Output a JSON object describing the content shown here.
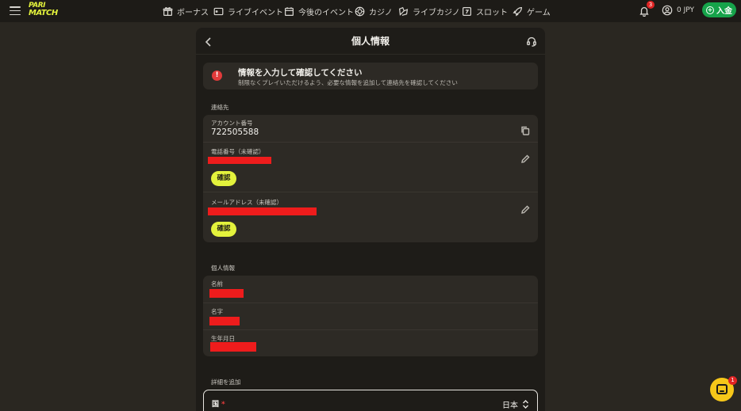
{
  "topbar": {
    "logo_line1": "PARI",
    "logo_line2": "MATCH",
    "nav": [
      {
        "label": "ボーナス",
        "icon": "gift-icon"
      },
      {
        "label": "ライブイベント",
        "icon": "live-tv-icon"
      },
      {
        "label": "今後のイベント",
        "icon": "calendar-icon"
      },
      {
        "label": "カジノ",
        "icon": "casino-chip-icon"
      },
      {
        "label": "ライブカジノ",
        "icon": "live-casino-icon"
      },
      {
        "label": "スロット",
        "icon": "slot-icon"
      },
      {
        "label": "ゲーム",
        "icon": "rocket-icon"
      }
    ],
    "notifications_count": "3",
    "balance": "0 JPY",
    "deposit_label": "入金"
  },
  "panel": {
    "title": "個人情報",
    "alert": {
      "title": "情報を入力して確認してください",
      "subtitle": "制限なくプレイいただけるよう、必要な情報を追加して連絡先を確認してください"
    },
    "contacts": {
      "section_label": "連絡先",
      "account_label": "アカウント番号",
      "account_value": "722505588",
      "phone_label": "電話番号（未確認）",
      "email_label": "メールアドレス（未確認）",
      "confirm_label": "確認"
    },
    "personal": {
      "section_label": "個人情報",
      "first_name_label": "名前",
      "last_name_label": "名字",
      "birthdate_label": "生年月日"
    },
    "details": {
      "section_label": "詳細を追加",
      "country_label": "国",
      "required_mark": "*",
      "country_value": "日本"
    }
  },
  "chat": {
    "badge": "1"
  },
  "colors": {
    "accent": "#e3f23c",
    "deposit": "#16a34a",
    "alert": "#e23b3b",
    "redaction": "#ee1c1c",
    "chat": "#f6c719"
  }
}
